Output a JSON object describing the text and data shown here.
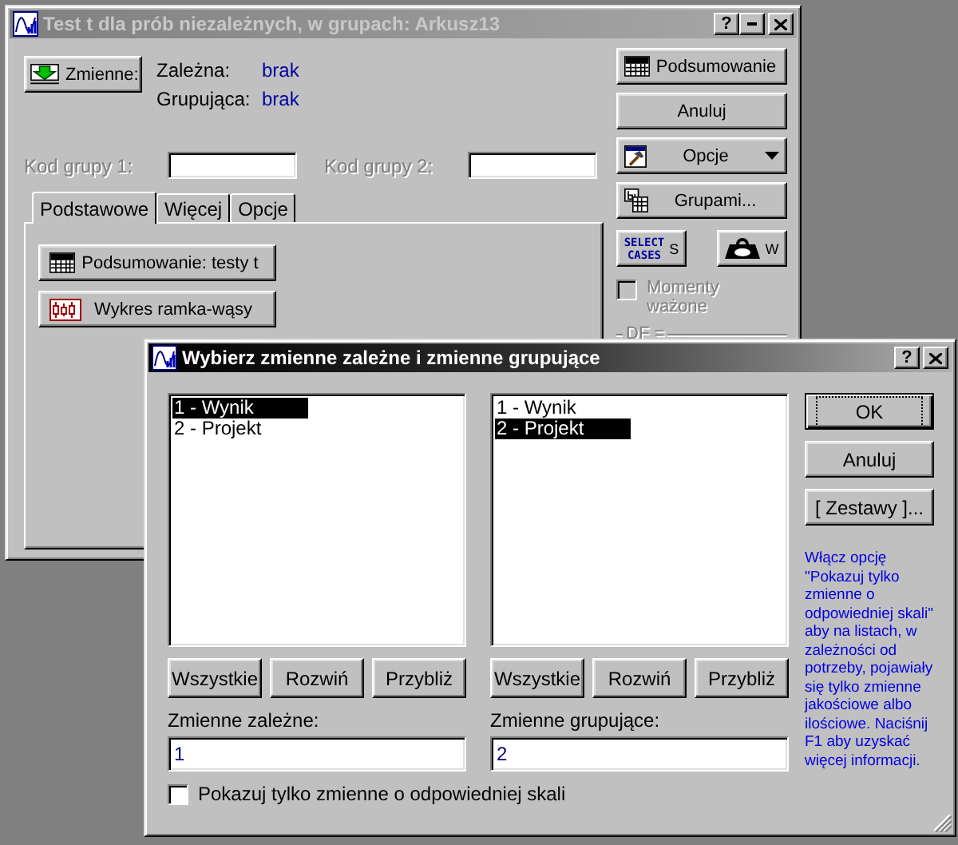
{
  "back_window": {
    "title": "Test t dla prób niezależnych, w grupach: Arkusz13",
    "active": false,
    "title_buttons": [
      {
        "kind": "help",
        "label": "?"
      },
      {
        "kind": "minimize"
      },
      {
        "kind": "close"
      }
    ],
    "variables_button": {
      "label": "Zmienne:"
    },
    "variables": [
      {
        "label": "Zależna:",
        "value": "brak"
      },
      {
        "label": "Grupująca:",
        "value": "brak"
      }
    ],
    "group_codes": [
      {
        "label": "Kod grupy 1:",
        "disabled": true
      },
      {
        "label": "Kod grupy 2:",
        "disabled": true
      }
    ],
    "tabs": [
      {
        "label": "Podstawowe",
        "selected": true
      },
      {
        "label": "Więcej",
        "selected": false
      },
      {
        "label": "Opcje",
        "selected": false
      }
    ],
    "tab_buttons": [
      {
        "label": "Podsumowanie: testy t",
        "kind": "summary"
      },
      {
        "label": "Wykres ramka-wąsy",
        "kind": "boxplot"
      }
    ],
    "side_buttons": [
      {
        "label": "Podsumowanie",
        "kind": "summary",
        "dropdown": false
      },
      {
        "label": "Anuluj",
        "kind": "plain",
        "dropdown": false
      },
      {
        "label": "Opcje",
        "kind": "options",
        "dropdown": true
      },
      {
        "label": "Grupami...",
        "kind": "by",
        "dropdown": false
      }
    ],
    "case_buttons": [
      {
        "label": "S",
        "kind": "select",
        "badge": "SELECT CASES"
      },
      {
        "label": "W",
        "kind": "weight"
      }
    ],
    "weighted_moments": {
      "label": "Momenty ważone",
      "checked": false,
      "disabled": true
    },
    "df_group": {
      "label": "DF ="
    }
  },
  "dialog": {
    "title": "Wybierz zmienne zależne i zmienne grupujące",
    "active": true,
    "title_buttons": [
      {
        "kind": "help",
        "label": "?"
      },
      {
        "kind": "close"
      }
    ],
    "lists": [
      {
        "items": [
          {
            "label": "1 - Wynik",
            "selected": true
          },
          {
            "label": "2 - Projekt",
            "selected": false
          }
        ],
        "buttons": [
          "Wszystkie",
          "Rozwiń",
          "Przybliż"
        ],
        "field_label": "Zmienne zależne:",
        "value": "1"
      },
      {
        "items": [
          {
            "label": "1 - Wynik",
            "selected": false
          },
          {
            "label": "2 - Projekt",
            "selected": true
          }
        ],
        "buttons": [
          "Wszystkie",
          "Rozwiń",
          "Przybliż"
        ],
        "field_label": "Zmienne grupujące:",
        "value": "2"
      }
    ],
    "buttons": [
      {
        "label": "OK",
        "default": true
      },
      {
        "label": "Anuluj",
        "default": false
      },
      {
        "label": "[ Zestawy ]...",
        "default": false
      }
    ],
    "hint": "Włącz opcję \"Pokazuj tylko zmienne o odpowiedniej skali\" aby na listach, w zależności od potrzeby, pojawiały się tylko zmienne jakościowe albo ilościowe. Naciśnij F1 aby uzyskać więcej informacji.",
    "filter_checkbox": {
      "label": "Pokazuj tylko zmienne o odpowiedniej skali",
      "checked": false
    }
  }
}
